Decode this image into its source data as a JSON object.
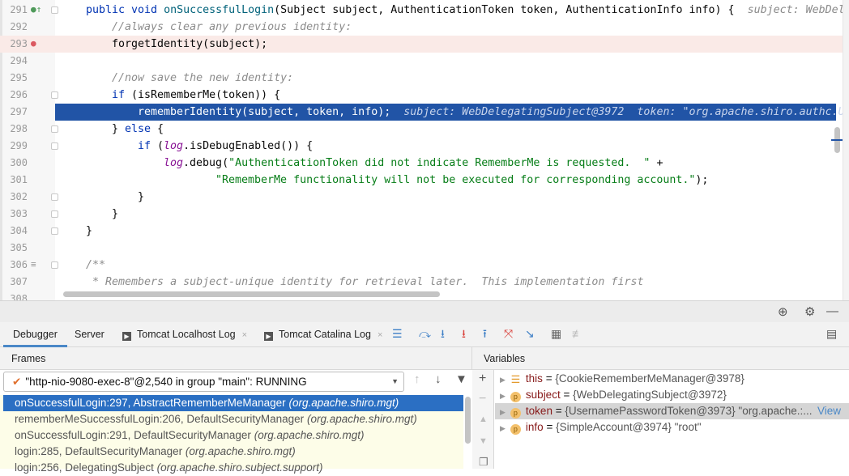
{
  "editor": {
    "lines": [
      {
        "n": "291",
        "icon": "override",
        "fold": true,
        "indent": 0,
        "segs": [
          {
            "t": "public void ",
            "c": "kw"
          },
          {
            "t": "onSuccessfulLogin",
            "c": "fn"
          },
          {
            "t": "(Subject subject, AuthenticationToken token, AuthenticationInfo info) {  ",
            "c": ""
          },
          {
            "t": "subject: WebDel",
            "c": "hint"
          }
        ]
      },
      {
        "n": "292",
        "indent": 4,
        "segs": [
          {
            "t": "//always clear any previous identity:",
            "c": "cm"
          }
        ]
      },
      {
        "n": "293",
        "icon": "breakpoint",
        "state": "bp",
        "indent": 4,
        "segs": [
          {
            "t": "forgetIdentity(subject);",
            "c": ""
          }
        ]
      },
      {
        "n": "294",
        "indent": 0,
        "segs": []
      },
      {
        "n": "295",
        "indent": 4,
        "segs": [
          {
            "t": "//now save the new identity:",
            "c": "cm"
          }
        ]
      },
      {
        "n": "296",
        "fold": true,
        "indent": 4,
        "segs": [
          {
            "t": "if ",
            "c": "kw"
          },
          {
            "t": "(isRememberMe(token)) {",
            "c": ""
          }
        ]
      },
      {
        "n": "297",
        "state": "cur",
        "indent": 8,
        "segs": [
          {
            "t": "rememberIdentity(subject, token, info);  ",
            "c": ""
          },
          {
            "t": "subject: WebDelegatingSubject@3972  token: \"org.apache.shiro.authc.U",
            "c": "hint"
          }
        ]
      },
      {
        "n": "298",
        "fold": true,
        "indent": 4,
        "segs": [
          {
            "t": "} ",
            "c": ""
          },
          {
            "t": "else ",
            "c": "kw"
          },
          {
            "t": "{",
            "c": ""
          }
        ]
      },
      {
        "n": "299",
        "fold": true,
        "indent": 8,
        "segs": [
          {
            "t": "if ",
            "c": "kw"
          },
          {
            "t": "(",
            "c": ""
          },
          {
            "t": "log",
            "c": "fld"
          },
          {
            "t": ".isDebugEnabled()) {",
            "c": ""
          }
        ]
      },
      {
        "n": "300",
        "indent": 12,
        "segs": [
          {
            "t": "log",
            "c": "fld"
          },
          {
            "t": ".debug(",
            "c": ""
          },
          {
            "t": "\"AuthenticationToken did not indicate RememberMe is requested.  \"",
            "c": "str"
          },
          {
            "t": " +",
            "c": ""
          }
        ]
      },
      {
        "n": "301",
        "indent": 20,
        "segs": [
          {
            "t": "\"RememberMe functionality will not be executed for corresponding account.\"",
            "c": "str"
          },
          {
            "t": ");",
            "c": ""
          }
        ]
      },
      {
        "n": "302",
        "fold": true,
        "indent": 8,
        "segs": [
          {
            "t": "}",
            "c": ""
          }
        ]
      },
      {
        "n": "303",
        "fold": true,
        "indent": 4,
        "segs": [
          {
            "t": "}",
            "c": ""
          }
        ]
      },
      {
        "n": "304",
        "fold": true,
        "indent": 0,
        "segs": [
          {
            "t": "}",
            "c": ""
          }
        ]
      },
      {
        "n": "305",
        "indent": 0,
        "segs": []
      },
      {
        "n": "306",
        "icon": "doc",
        "fold": true,
        "indent": 0,
        "segs": [
          {
            "t": "/**",
            "c": "cm"
          }
        ]
      },
      {
        "n": "307",
        "indent": 1,
        "segs": [
          {
            "t": "* Remembers a subject-unique identity for retrieval later.  This implementation first",
            "c": "cm"
          }
        ]
      },
      {
        "n": "308",
        "indent": 0,
        "segs": []
      }
    ]
  },
  "debug_panel": {
    "tabs": [
      {
        "label": "Debugger",
        "active": true
      },
      {
        "label": "Server"
      },
      {
        "label": "Tomcat Localhost Log",
        "closable": true
      },
      {
        "label": "Tomcat Catalina Log",
        "closable": true
      }
    ],
    "close_glyph": "×",
    "frames_title": "Frames",
    "variables_title": "Variables",
    "thread": "\"http-nio-9080-exec-8\"@2,540 in group \"main\": RUNNING",
    "frames": [
      {
        "method": "onSuccessfulLogin:297, AbstractRememberMeManager",
        "pkg": "(org.apache.shiro.mgt)",
        "selected": true
      },
      {
        "method": "rememberMeSuccessfulLogin:206, DefaultSecurityManager",
        "pkg": "(org.apache.shiro.mgt)"
      },
      {
        "method": "onSuccessfulLogin:291, DefaultSecurityManager",
        "pkg": "(org.apache.shiro.mgt)"
      },
      {
        "method": "login:285, DefaultSecurityManager",
        "pkg": "(org.apache.shiro.mgt)"
      },
      {
        "method": "login:256, DelegatingSubject",
        "pkg": "(org.apache.shiro.subject.support)"
      }
    ],
    "variables": [
      {
        "name": "this",
        "value": "{CookieRememberMeManager@3978}",
        "icon": "list"
      },
      {
        "name": "subject",
        "value": "{WebDelegatingSubject@3972}",
        "icon": "p"
      },
      {
        "name": "token",
        "value": "{UsernamePasswordToken@3973} \"org.apache.:...",
        "icon": "p",
        "selected": true,
        "link": "View"
      },
      {
        "name": "info",
        "value": "{SimpleAccount@3974} \"root\"",
        "icon": "p"
      }
    ],
    "eq": " = "
  },
  "colors": {
    "accent": "#2154a6",
    "selection": "#2b6fc3",
    "breakpoint_line": "#faeae7",
    "string": "#067d17",
    "keyword": "#0033b3"
  }
}
